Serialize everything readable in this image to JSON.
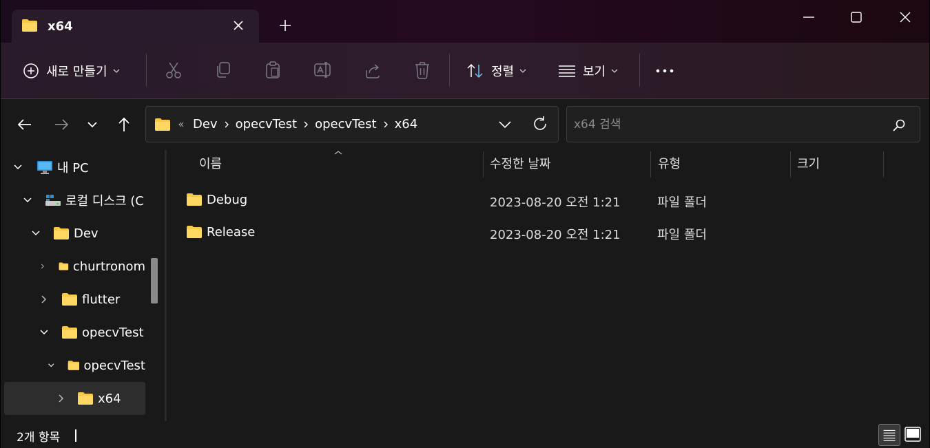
{
  "tab": {
    "title": "x64"
  },
  "commandbar": {
    "new_label": "새로 만들기",
    "sort_label": "정렬",
    "view_label": "보기"
  },
  "address": {
    "crumbs": [
      "Dev",
      "opecvTest",
      "opecvTest",
      "x64"
    ]
  },
  "search": {
    "placeholder": "x64 검색"
  },
  "sidebar": {
    "items": [
      {
        "label": "내 PC"
      },
      {
        "label": "로컬 디스크 (C"
      },
      {
        "label": "Dev"
      },
      {
        "label": "churtronom"
      },
      {
        "label": "flutter"
      },
      {
        "label": "opecvTest"
      },
      {
        "label": "opecvTest"
      },
      {
        "label": "x64"
      }
    ]
  },
  "columns": {
    "name": "이름",
    "modified": "수정한 날짜",
    "type": "유형",
    "size": "크기"
  },
  "files": [
    {
      "name": "Debug",
      "modified": "2023-08-20 오전 1:21",
      "type": "파일 폴더"
    },
    {
      "name": "Release",
      "modified": "2023-08-20 오전 1:21",
      "type": "파일 폴더"
    }
  ],
  "status": {
    "count_text": "2개 항목"
  },
  "colors": {
    "folder": "#f8c84a",
    "selected": "#2d2d2d"
  }
}
